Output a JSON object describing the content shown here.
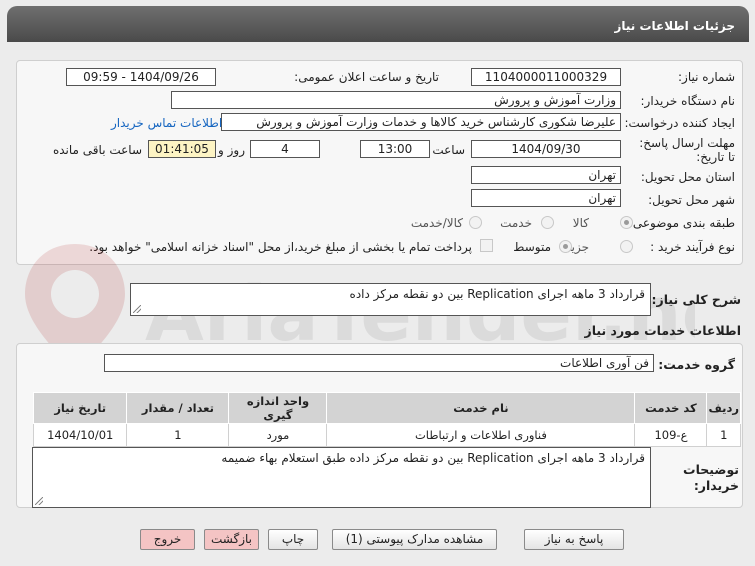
{
  "header": {
    "title": "جزئیات اطلاعات نیاز"
  },
  "form": {
    "need_number_label": "شماره نیاز:",
    "need_number": "1104000011000329",
    "announce_label": "تاریخ و ساعت اعلان عمومی:",
    "announce_value": "1404/09/26 - 09:59",
    "buyer_org_label": "نام دستگاه خریدار:",
    "buyer_org": "وزارت آموزش و پرورش",
    "creator_label": "ایجاد کننده درخواست:",
    "creator": "علیرضا شکوری کارشناس خرید کالاها و خدمات وزارت آموزش و پرورش",
    "contact_link": "اطلاعات تماس خریدار",
    "deadline_label": "مهلت ارسال پاسخ: تا تاریخ:",
    "deadline_date": "1404/09/30",
    "time_label": "ساعت",
    "deadline_time": "13:00",
    "days_value": "4",
    "days_label": "روز و",
    "remaining_time": "01:41:05",
    "remaining_label": "ساعت باقی مانده",
    "province_label": "استان محل تحویل:",
    "province": "تهران",
    "city_label": "شهر محل تحویل:",
    "city": "تهران",
    "category_label": "طبقه بندی موضوعی:",
    "category_options": [
      "کالا",
      "خدمت",
      "کالا/خدمت"
    ],
    "process_label": "نوع فرآیند خرید :",
    "process_options": [
      "جزیی",
      "متوسط"
    ],
    "payment_note": "پرداخت تمام یا بخشی از مبلغ خرید،از محل \"اسناد خزانه اسلامی\" خواهد بود."
  },
  "summary": {
    "label": "شرح کلی نیاز:",
    "text": "قرارداد 3 ماهه اجرای Replication بین دو نقطه مرکز داده"
  },
  "services": {
    "section_title": "اطلاعات خدمات مورد نیاز",
    "group_label": "گروه خدمت:",
    "group_value": "فن آوری اطلاعات",
    "table": {
      "headers": [
        "ردیف",
        "کد خدمت",
        "نام خدمت",
        "واحد اندازه گیری",
        "تعداد / مقدار",
        "تاریخ نیاز"
      ],
      "rows": [
        [
          "1",
          "ع-109",
          "فناوری اطلاعات و ارتباطات",
          "مورد",
          "1",
          "1404/10/01"
        ]
      ]
    }
  },
  "buyer_notes": {
    "label": "توضیحات خریدار:",
    "text": "قرارداد 3 ماهه اجرای Replication بین دو نقطه مرکز داده طبق استعلام بهاء ضمیمه"
  },
  "buttons": {
    "reply": "پاسخ به نیاز",
    "attachments": "مشاهده مدارک پیوستی (1)",
    "print": "چاپ",
    "back": "بازگشت",
    "exit": "خروج"
  },
  "watermark": {
    "text": "AriaTender.net"
  }
}
